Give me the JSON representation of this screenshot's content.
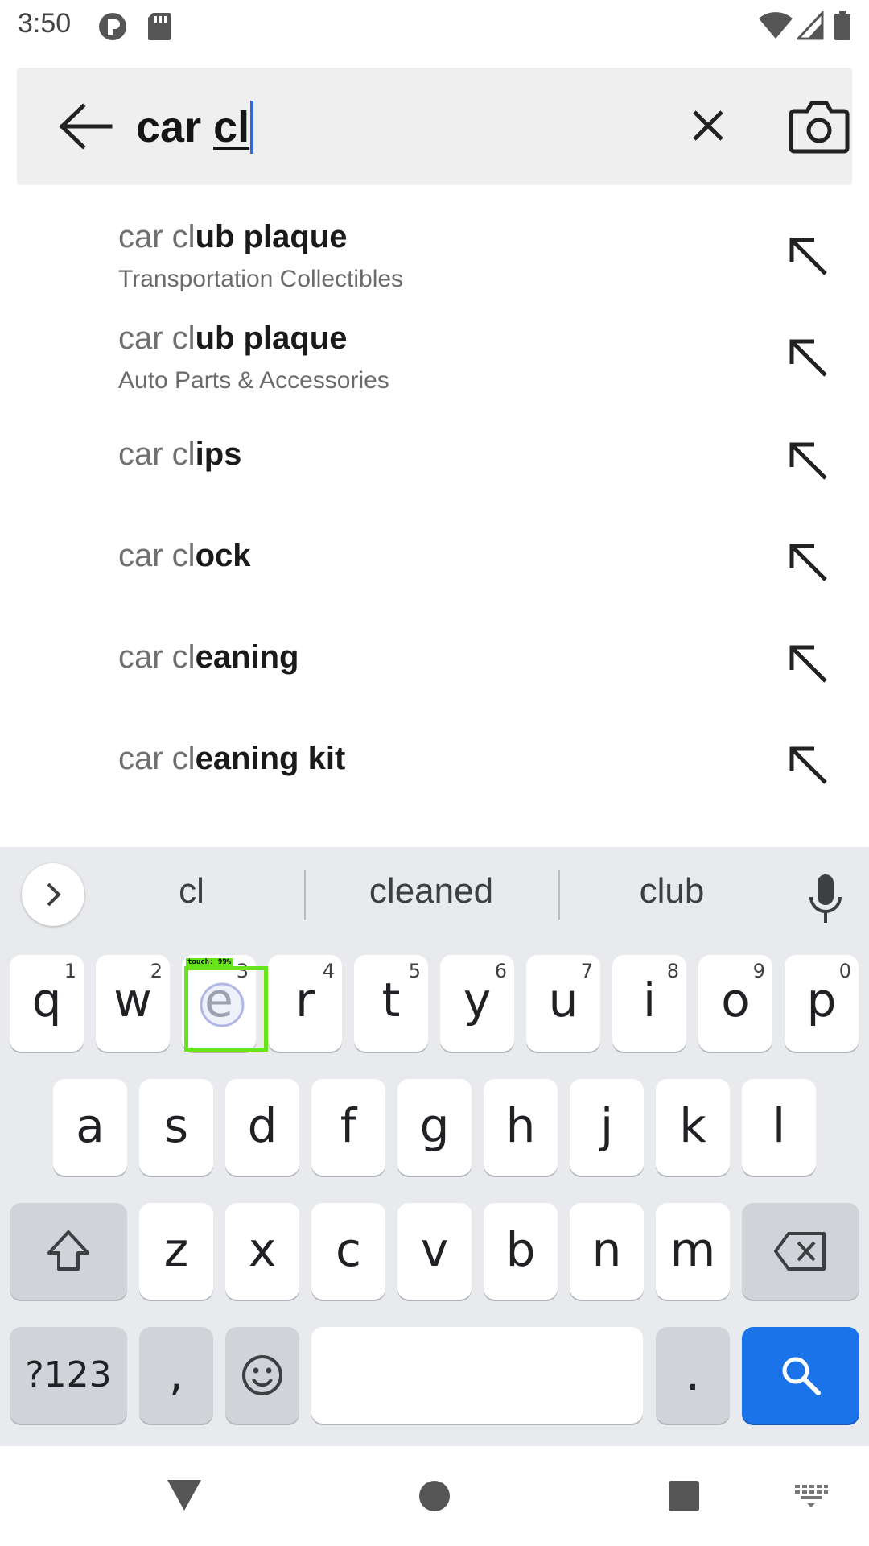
{
  "status_bar": {
    "time": "3:50",
    "icons": [
      "app-badge-icon",
      "sd-card-icon",
      "wifi-icon",
      "signal-icon",
      "battery-icon"
    ]
  },
  "search": {
    "query_prefix": "car ",
    "query_typed": "cl",
    "back_icon": "back-arrow-icon",
    "clear_icon": "close-icon",
    "camera_icon": "camera-icon"
  },
  "suggestions": [
    {
      "prefix": "car cl",
      "completion": "ub plaque",
      "category": "Transportation Collectibles"
    },
    {
      "prefix": "car cl",
      "completion": "ub plaque",
      "category": "Auto Parts & Accessories"
    },
    {
      "prefix": "car cl",
      "completion": "ips",
      "category": ""
    },
    {
      "prefix": "car cl",
      "completion": "ock",
      "category": ""
    },
    {
      "prefix": "car cl",
      "completion": "eaning",
      "category": ""
    },
    {
      "prefix": "car cl",
      "completion": "eaning kit",
      "category": ""
    }
  ],
  "keyboard": {
    "word_suggestions": [
      "cl",
      "cleaned",
      "club"
    ],
    "row1": [
      {
        "key": "q",
        "hint": "1"
      },
      {
        "key": "w",
        "hint": "2"
      },
      {
        "key": "e",
        "hint": "3"
      },
      {
        "key": "r",
        "hint": "4"
      },
      {
        "key": "t",
        "hint": "5"
      },
      {
        "key": "y",
        "hint": "6"
      },
      {
        "key": "u",
        "hint": "7"
      },
      {
        "key": "i",
        "hint": "8"
      },
      {
        "key": "o",
        "hint": "9"
      },
      {
        "key": "p",
        "hint": "0"
      }
    ],
    "row2": [
      "a",
      "s",
      "d",
      "f",
      "g",
      "h",
      "j",
      "k",
      "l"
    ],
    "row3": [
      "z",
      "x",
      "c",
      "v",
      "b",
      "n",
      "m"
    ],
    "symbols_label": "?123",
    "comma_label": ",",
    "period_label": ".",
    "touch_overlay_label": "touch: 99%",
    "accent_color": "#1a73e8"
  },
  "nav_bar": {
    "icons": [
      "back-triangle-icon",
      "home-circle-icon",
      "recents-square-icon",
      "keyboard-switch-icon"
    ]
  }
}
